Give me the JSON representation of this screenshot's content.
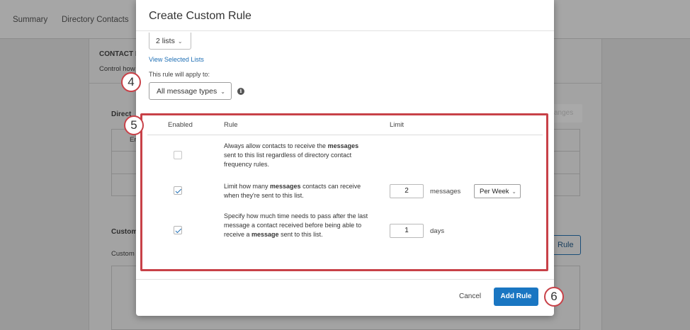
{
  "background": {
    "nav": [
      "Summary",
      "Directory Contacts"
    ],
    "contact_heading": "CONTACT F",
    "contact_sub": "Control how",
    "directory_label": "Direct",
    "col_fragment": "En",
    "disabled_button": "anges",
    "custom_heading": "Custom",
    "custom_sub": "Custom",
    "outline_button": "Rule"
  },
  "modal": {
    "title": "Create Custom Rule",
    "lists_select": "2 lists",
    "view_lists_link": "View Selected Lists",
    "apply_label": "This rule will apply to:",
    "type_select": "All message types",
    "table": {
      "headers": [
        "Enabled",
        "Rule",
        "Limit"
      ],
      "rows": [
        {
          "enabled": false,
          "rule_parts": [
            "Always allow contacts to receive the ",
            "messages",
            " sent to this list regardless of directory contact frequency rules."
          ]
        },
        {
          "enabled": true,
          "rule_parts": [
            "Limit how many ",
            "messages",
            " contacts can receive when they're sent to this list."
          ],
          "limit_value": "2",
          "limit_unit": "messages",
          "frequency": "Per Week"
        },
        {
          "enabled": true,
          "rule_parts": [
            "Specify how much time needs to pass after the last message a contact received before being able to receive a ",
            "message",
            " sent to this list."
          ],
          "limit_value": "1",
          "limit_unit": "days"
        }
      ]
    },
    "cancel_label": "Cancel",
    "add_label": "Add Rule"
  },
  "callouts": [
    "4",
    "5",
    "6"
  ],
  "colors": {
    "accent": "#1a76c2",
    "callout_red": "#c84148",
    "link": "#1f6fb5"
  },
  "icons": [
    "chevron-down-icon",
    "info-icon",
    "checkmark-icon"
  ]
}
